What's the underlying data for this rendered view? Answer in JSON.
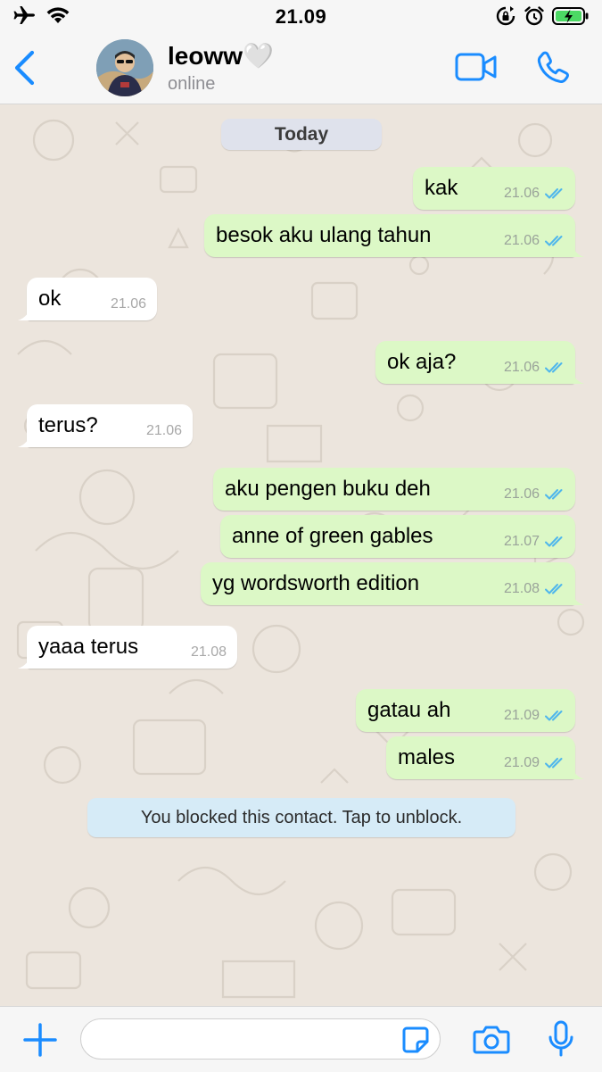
{
  "status_bar": {
    "time": "21.09",
    "icons": [
      "airplane-icon",
      "wifi-icon",
      "orientation-lock-icon",
      "alarm-icon",
      "battery-charging-icon"
    ]
  },
  "header": {
    "contact_name": "leoww🤍",
    "contact_status": "online",
    "icons": [
      "back-chevron-icon",
      "avatar",
      "video-call-icon",
      "phone-call-icon"
    ]
  },
  "chat": {
    "date_label": "Today",
    "messages": [
      {
        "dir": "out",
        "text": "kak",
        "time": "21.06"
      },
      {
        "dir": "out",
        "text": "besok aku ulang tahun",
        "time": "21.06"
      },
      {
        "dir": "in",
        "text": "ok",
        "time": "21.06"
      },
      {
        "dir": "out",
        "text": "ok aja?",
        "time": "21.06"
      },
      {
        "dir": "in",
        "text": "terus?",
        "time": "21.06"
      },
      {
        "dir": "out",
        "text": "aku pengen buku deh",
        "time": "21.06"
      },
      {
        "dir": "out",
        "text": "anne of green gables",
        "time": "21.07"
      },
      {
        "dir": "out",
        "text": "yg wordsworth edition",
        "time": "21.08"
      },
      {
        "dir": "in",
        "text": "yaaa terus",
        "time": "21.08"
      },
      {
        "dir": "out",
        "text": "gatau ah",
        "time": "21.09"
      },
      {
        "dir": "out",
        "text": "males",
        "time": "21.09"
      }
    ],
    "blocked_notice": "You blocked this contact. Tap to unblock."
  },
  "input_bar": {
    "message_value": "",
    "icons": [
      "plus-icon",
      "sticker-icon",
      "camera-icon",
      "microphone-icon"
    ]
  },
  "colors": {
    "accent": "#1a8cff",
    "outgoing_bubble": "#dcf8c6",
    "incoming_bubble": "#ffffff",
    "chat_background": "#ece5dd",
    "read_ticks": "#4fb6ec",
    "system_notice": "#d6ebf7"
  }
}
